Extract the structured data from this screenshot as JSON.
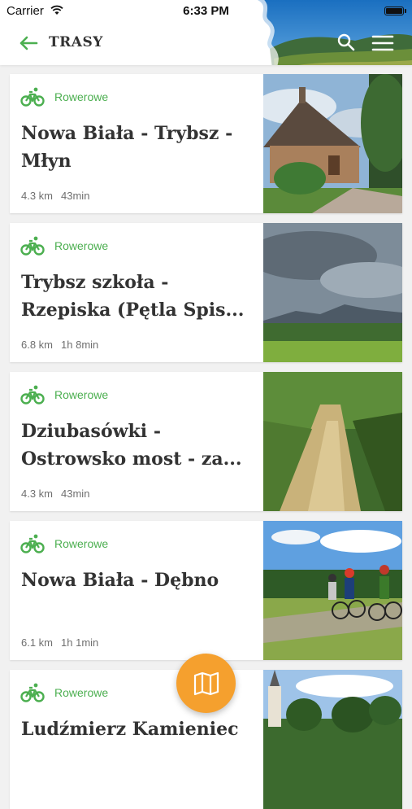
{
  "status_bar": {
    "carrier": "Carrier",
    "time": "6:33 PM"
  },
  "header": {
    "title": "TRASY"
  },
  "colors": {
    "accent_green": "#4caf50",
    "fab_orange": "#f5a02e",
    "title_text": "#333333",
    "meta_text": "#6f6f6f"
  },
  "routes": [
    {
      "type": "Rowerowe",
      "title": "Nowa Biała - Trybsz -\nMłyn",
      "distance": "4.3 km",
      "duration": "43min",
      "image": "wooden-church"
    },
    {
      "type": "Rowerowe",
      "title": "Trybsz szkoła -\nRzepiska (Pętla Spis...",
      "distance": "6.8 km",
      "duration": "1h  8min",
      "image": "mountain-valley"
    },
    {
      "type": "Rowerowe",
      "title": "Dziubasówki -\nOstrowsko most - za...",
      "distance": "4.3 km",
      "duration": "43min",
      "image": "forest-path"
    },
    {
      "type": "Rowerowe",
      "title": "Nowa Biała - Dębno",
      "distance": "6.1 km",
      "duration": "1h  1min",
      "image": "cyclists"
    },
    {
      "type": "Rowerowe",
      "title": "Ludźmierz Kamieniec",
      "distance": "",
      "duration": "",
      "image": "village-church"
    }
  ],
  "fab": {
    "icon": "map-icon"
  }
}
